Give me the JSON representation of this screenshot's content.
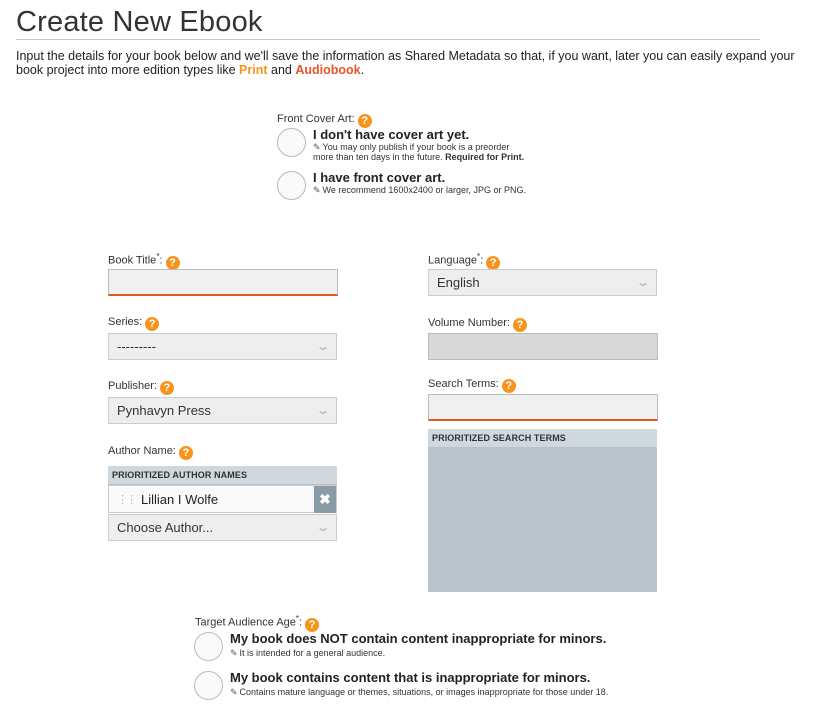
{
  "page": {
    "title": "Create New Ebook",
    "intro_text": "Input the details for your book below and we'll save the information as Shared Metadata so that, if you want, later you can easily expand your book project into more edition types like ",
    "intro_print": "Print",
    "intro_and": " and ",
    "intro_audiobook": "Audiobook",
    "intro_end": "."
  },
  "colors": {
    "accent_orange": "#f7941d",
    "accent_red": "#e8542a",
    "list_header_bg": "#cfd8dd",
    "list_body_bg": "#b9c4ca"
  },
  "help_icon": {
    "glyph": "?",
    "name": "question-circle-icon"
  },
  "cover_art": {
    "label": "Front Cover Art:",
    "options": [
      {
        "title": "I don't have cover art yet.",
        "desc_line1": "You may only publish if your book is a preorder",
        "desc_line2": "more than ten days in the future. ",
        "desc_strong": "Required for Print."
      },
      {
        "title": "I have front cover art.",
        "desc_line1": "We recommend 1600x2400 or larger, JPG or PNG."
      }
    ]
  },
  "fields": {
    "book_title": {
      "label": "Book Title",
      "required": "*",
      "suffix": ":",
      "value": ""
    },
    "series": {
      "label": "Series:",
      "value": "---------"
    },
    "publisher": {
      "label": "Publisher:",
      "value": "Pynhavyn Press"
    },
    "author_name": {
      "label": "Author Name:",
      "list_header": "PRIORITIZED AUTHOR NAMES",
      "authors": [
        "Lillian I Wolfe"
      ],
      "remove_glyph": "✖",
      "drag_glyph": "⋮⋮",
      "choose_placeholder": "Choose Author..."
    },
    "language": {
      "label": "Language",
      "required": "*",
      "suffix": ":",
      "value": "English"
    },
    "volume_number": {
      "label": "Volume Number:",
      "value": ""
    },
    "search_terms": {
      "label": "Search Terms:",
      "value": "",
      "list_header": "PRIORITIZED SEARCH TERMS",
      "terms": []
    }
  },
  "audience": {
    "label": "Target Audience Age",
    "required": "*",
    "suffix": ":",
    "options": [
      {
        "title": "My book does NOT contain content inappropriate for minors.",
        "desc": "It is intended for a general audience."
      },
      {
        "title": "My book contains content that is inappropriate for minors.",
        "desc": "Contains mature language or themes, situations, or images inappropriate for those under 18."
      }
    ]
  },
  "glyphs": {
    "edit": "✎",
    "chevron": "⌄"
  }
}
